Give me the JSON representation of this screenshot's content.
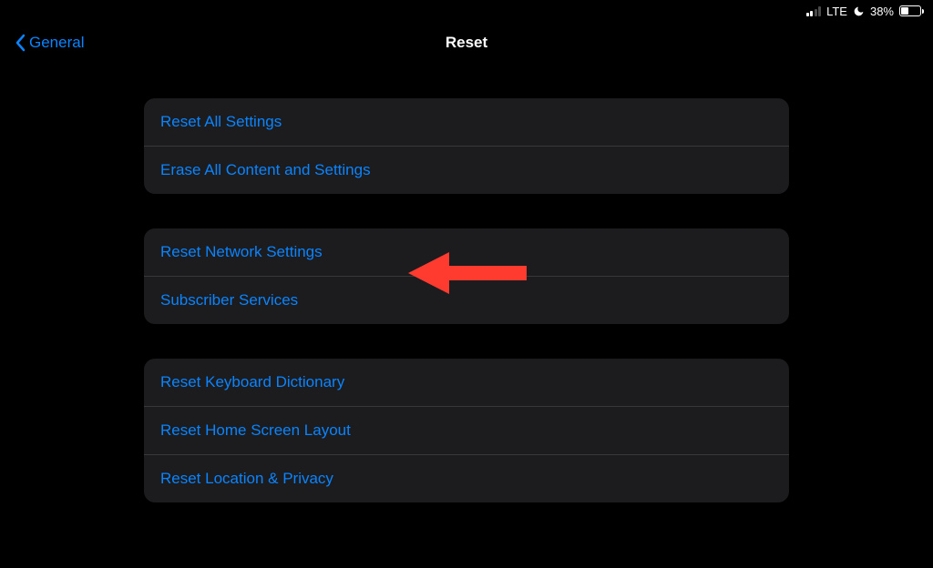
{
  "statusBar": {
    "network": "LTE",
    "batteryPercent": "38%",
    "batteryFill": 38
  },
  "nav": {
    "back": "General",
    "title": "Reset"
  },
  "groups": [
    {
      "items": [
        {
          "label": "Reset All Settings"
        },
        {
          "label": "Erase All Content and Settings"
        }
      ]
    },
    {
      "items": [
        {
          "label": "Reset Network Settings"
        },
        {
          "label": "Subscriber Services"
        }
      ]
    },
    {
      "items": [
        {
          "label": "Reset Keyboard Dictionary"
        },
        {
          "label": "Reset Home Screen Layout"
        },
        {
          "label": "Reset Location & Privacy"
        }
      ]
    }
  ]
}
